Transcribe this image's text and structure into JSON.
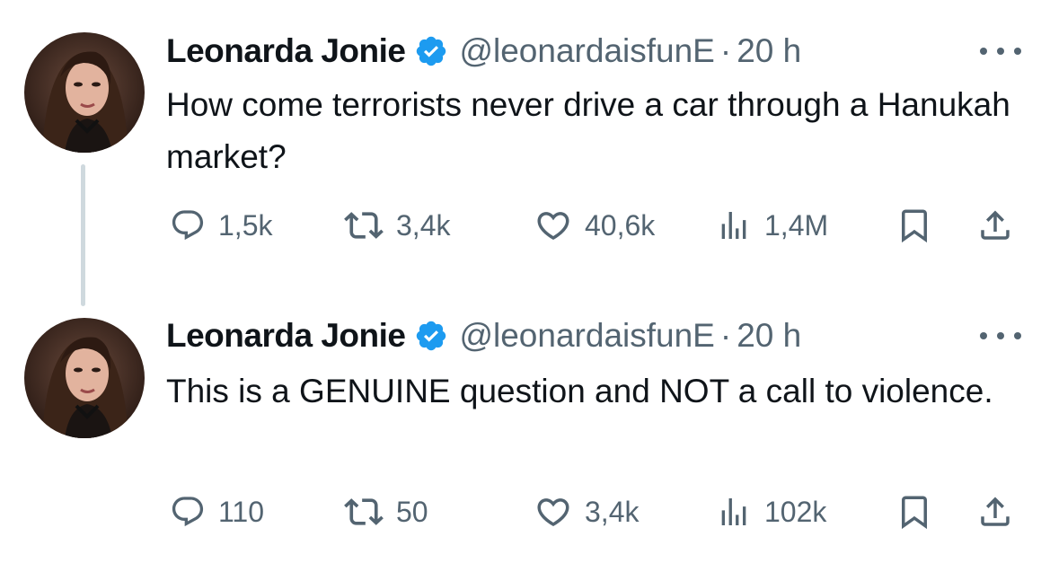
{
  "colors": {
    "text": "#0f1419",
    "secondary": "#536471",
    "verified_blue": "#1d9bf0",
    "thread_line": "#cfd9de"
  },
  "tweets": [
    {
      "author": {
        "name": "Leonarda Jonie",
        "handle": "@leonardaisfunE",
        "verified": true,
        "avatar": "avatar-photo"
      },
      "separator": "·",
      "time": "20 h",
      "text": "How come terrorists never drive a car through a Hanukah market?",
      "stats": {
        "replies": "1,5k",
        "reposts": "3,4k",
        "likes": "40,6k",
        "views": "1,4M"
      },
      "icons": {
        "reply": "speech-bubble-icon",
        "repost": "repost-arrows-icon",
        "like": "heart-icon",
        "views": "bar-chart-icon",
        "bookmark": "bookmark-icon",
        "share": "share-upload-icon",
        "more": "more-dots-icon"
      }
    },
    {
      "author": {
        "name": "Leonarda Jonie",
        "handle": "@leonardaisfunE",
        "verified": true,
        "avatar": "avatar-photo"
      },
      "separator": "·",
      "time": "20 h",
      "text": "This is a GENUINE question and NOT a call to violence.",
      "stats": {
        "replies": "110",
        "reposts": "50",
        "likes": "3,4k",
        "views": "102k"
      },
      "icons": {
        "reply": "speech-bubble-icon",
        "repost": "repost-arrows-icon",
        "like": "heart-icon",
        "views": "bar-chart-icon",
        "bookmark": "bookmark-icon",
        "share": "share-upload-icon",
        "more": "more-dots-icon"
      }
    }
  ]
}
